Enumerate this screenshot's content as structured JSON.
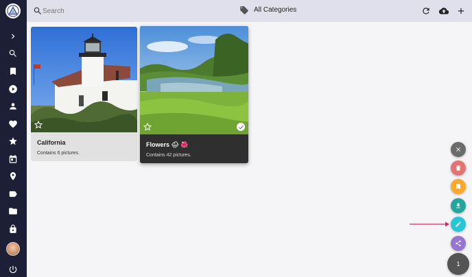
{
  "sidebar": {
    "items": [
      {
        "icon": "chevron-right-icon"
      },
      {
        "icon": "search-icon"
      },
      {
        "icon": "bookmark-icon"
      },
      {
        "icon": "play-icon"
      },
      {
        "icon": "person-icon"
      },
      {
        "icon": "heart-icon"
      },
      {
        "icon": "star-icon"
      },
      {
        "icon": "calendar-icon"
      },
      {
        "icon": "location-pin-icon"
      },
      {
        "icon": "label-icon"
      },
      {
        "icon": "folder-icon"
      },
      {
        "icon": "lock-icon"
      },
      {
        "icon": "avatar"
      },
      {
        "icon": "power-icon"
      }
    ]
  },
  "topbar": {
    "search_placeholder": "Search",
    "category": "All Categories"
  },
  "cards": [
    {
      "title": "California",
      "subtitle": "Contains 6 pictures.",
      "selected": false
    },
    {
      "title": "Flowers 🌧 🌺",
      "subtitle": "Contains 42 pictures.",
      "selected": true
    }
  ],
  "fab": {
    "count": "1",
    "buttons": [
      {
        "icon": "close-icon",
        "color": "#6b6b6b"
      },
      {
        "icon": "delete-icon",
        "color": "#e57373"
      },
      {
        "icon": "bookmark-icon",
        "color": "#ffa726"
      },
      {
        "icon": "download-icon",
        "color": "#26a69a"
      },
      {
        "icon": "edit-icon",
        "color": "#26c6da"
      },
      {
        "icon": "share-icon",
        "color": "#9575cd"
      }
    ]
  },
  "colors": {
    "sidebar_bg": "#1d1f36",
    "topbar_bg": "#dfe0eb",
    "arrow": "#e91e63"
  }
}
